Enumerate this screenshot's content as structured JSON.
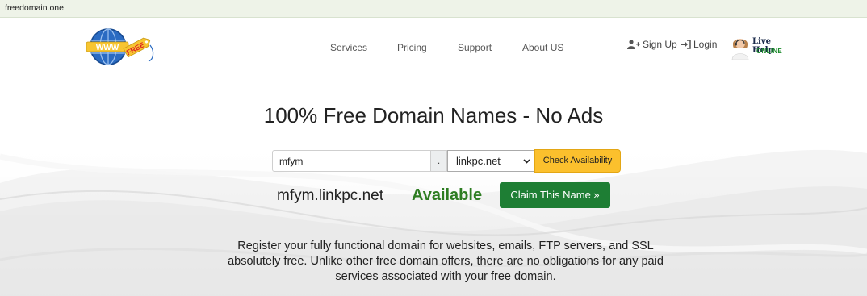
{
  "browser": {
    "url": "freedomain.one"
  },
  "header": {
    "logo": {
      "text": "WWW",
      "tag": "FREE"
    },
    "nav": [
      {
        "label": "Services"
      },
      {
        "label": "Pricing"
      },
      {
        "label": "Support"
      },
      {
        "label": "About US"
      }
    ],
    "auth": {
      "signup": "Sign Up",
      "login": "Login"
    },
    "live_help": {
      "title": "Live Help",
      "status": "ONLINE"
    }
  },
  "hero": {
    "headline": "100% Free Domain Names - No Ads"
  },
  "search": {
    "value": "mfym",
    "separator": ".",
    "tld_selected": "linkpc.net",
    "button_label": "Check Availability"
  },
  "result": {
    "domain": "mfym.linkpc.net",
    "status": "Available",
    "button_label": "Claim This Name »"
  },
  "description": "Register your fully functional domain for websites, emails, FTP servers, and SSL absolutely free. Unlike other free domain offers, there are no obligations for any paid services associated with your free domain.",
  "colors": {
    "accent_yellow": "#fbc02d",
    "success_green": "#1e7e34",
    "available_text": "#2e7d22",
    "browser_bar": "#eef3e8"
  },
  "icons": [
    "user-plus-icon",
    "sign-in-icon",
    "chevron-down-icon",
    "globe-logo-icon",
    "support-agent-avatar"
  ]
}
